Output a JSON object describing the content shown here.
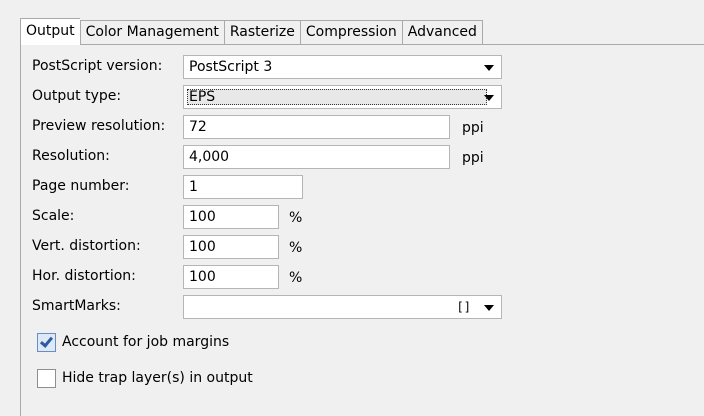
{
  "tabs": [
    {
      "label": "Output",
      "active": true
    },
    {
      "label": "Color Management",
      "active": false
    },
    {
      "label": "Rasterize",
      "active": false
    },
    {
      "label": "Compression",
      "active": false
    },
    {
      "label": "Advanced",
      "active": false
    }
  ],
  "form": {
    "postscript_version": {
      "label": "PostScript version:",
      "value": "PostScript 3"
    },
    "output_type": {
      "label": "Output type:",
      "value": "EPS"
    },
    "preview_resolution": {
      "label": "Preview resolution:",
      "value": "72",
      "unit": "ppi"
    },
    "resolution": {
      "label": "Resolution:",
      "value": "4,000",
      "unit": "ppi"
    },
    "page_number": {
      "label": "Page number:",
      "value": "1"
    },
    "scale": {
      "label": "Scale:",
      "value": "100",
      "unit": "%"
    },
    "vert_distortion": {
      "label": "Vert. distortion:",
      "value": "100",
      "unit": "%"
    },
    "hor_distortion": {
      "label": "Hor. distortion:",
      "value": "100",
      "unit": "%"
    },
    "smartmarks": {
      "label": "SmartMarks:",
      "value": "",
      "bracket": "[]"
    }
  },
  "checkboxes": {
    "account_for_job_margins": {
      "label": "Account for job margins",
      "checked": true
    },
    "hide_trap_layers": {
      "label": "Hide trap layer(s) in output",
      "checked": false
    }
  }
}
